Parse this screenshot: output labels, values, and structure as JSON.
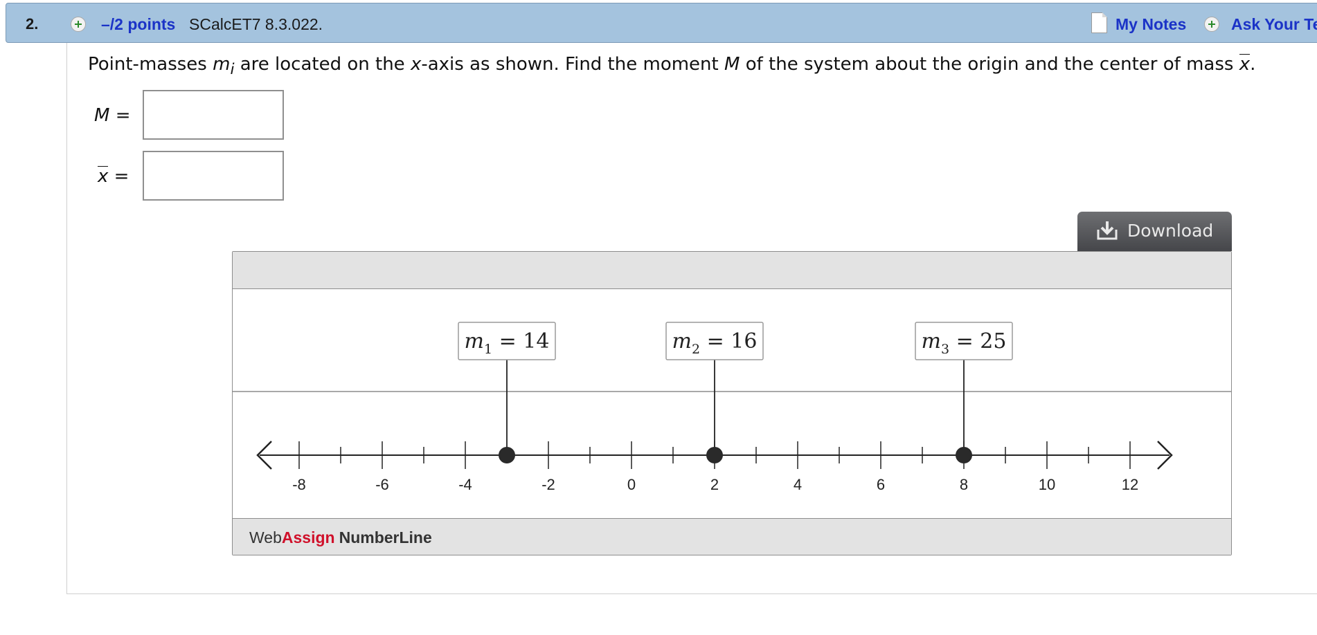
{
  "question": {
    "number": "2.",
    "points": "–/2 points",
    "id": "SCalcET7 8.3.022.",
    "my_notes": "My Notes",
    "ask_teacher": "Ask Your Te",
    "prompt_parts": {
      "p1": "Point-masses ",
      "m": "m",
      "i": "i",
      "p2": " are located on the ",
      "x": "x",
      "p3": "-axis as shown. Find the moment ",
      "M": "M",
      "p4": " of the system about the origin and the center of mass ",
      "xbar": "x",
      "p5": "."
    }
  },
  "answers": {
    "moment": {
      "var": "M",
      "eq": "=",
      "value": ""
    },
    "center": {
      "var": "x",
      "eq": "=",
      "value": ""
    }
  },
  "download": {
    "label": "Download",
    "icon": "download-icon"
  },
  "numberline": {
    "brand_web": "Web",
    "brand_assign": "Assign",
    "brand_name": "NumberLine",
    "ticks": [
      "-8",
      "-6",
      "-4",
      "-2",
      "0",
      "2",
      "4",
      "6",
      "8",
      "10",
      "12"
    ],
    "x_range": [
      -9,
      13
    ],
    "masses": [
      {
        "sym": "m",
        "sub": "1",
        "eq": "=",
        "value": "14",
        "position": -3
      },
      {
        "sym": "m",
        "sub": "2",
        "eq": "=",
        "value": "16",
        "position": 2
      },
      {
        "sym": "m",
        "sub": "3",
        "eq": "=",
        "value": "25",
        "position": 8
      }
    ]
  },
  "colors": {
    "header_bg": "#a4c3de",
    "link": "#1b33c7",
    "brand_red": "#d0112b",
    "point": "#2a2a2a"
  }
}
